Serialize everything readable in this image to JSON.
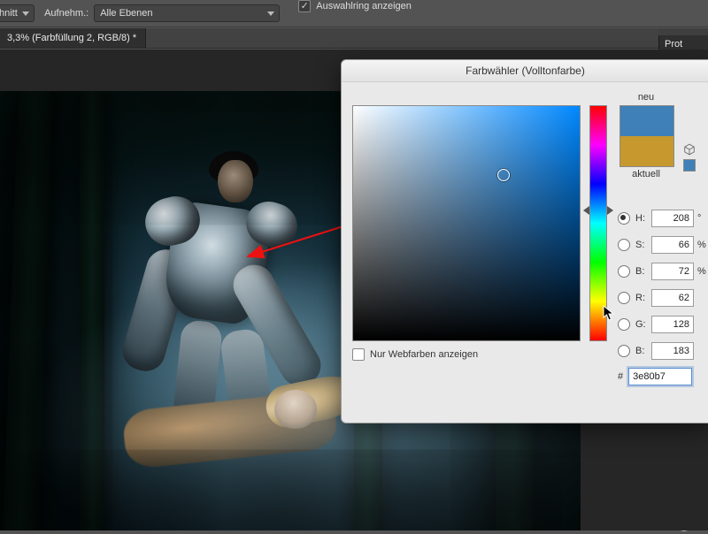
{
  "optbar": {
    "sample_avg_label": "el Durchschnitt",
    "sample_layers_label": "Aufnehm.:",
    "sample_layers_value": "Alle Ebenen",
    "show_ring_label": "Auswahlring anzeigen",
    "show_ring_checked": true
  },
  "doc_tab": {
    "title": "3,3% (Farbfüllung 2, RGB/8) *"
  },
  "right_panel": {
    "tab": "Prot"
  },
  "picker": {
    "title": "Farbwähler (Volltonfarbe)",
    "new_label": "neu",
    "current_label": "aktuell",
    "new_color": "#3e80b7",
    "current_color": "#c7982d",
    "webonly_label": "Nur Webfarben anzeigen",
    "hash": "#",
    "hex": "3e80b7",
    "fields": [
      {
        "key": "H",
        "value": "208",
        "unit": "°",
        "selected": true
      },
      {
        "key": "S",
        "value": "66",
        "unit": "%",
        "selected": false
      },
      {
        "key": "B",
        "value": "72",
        "unit": "%",
        "selected": false
      },
      {
        "key": "R",
        "value": "62",
        "unit": "",
        "selected": false
      },
      {
        "key": "G",
        "value": "128",
        "unit": "",
        "selected": false
      },
      {
        "key": "B",
        "value": "183",
        "unit": "",
        "selected": false
      }
    ]
  }
}
